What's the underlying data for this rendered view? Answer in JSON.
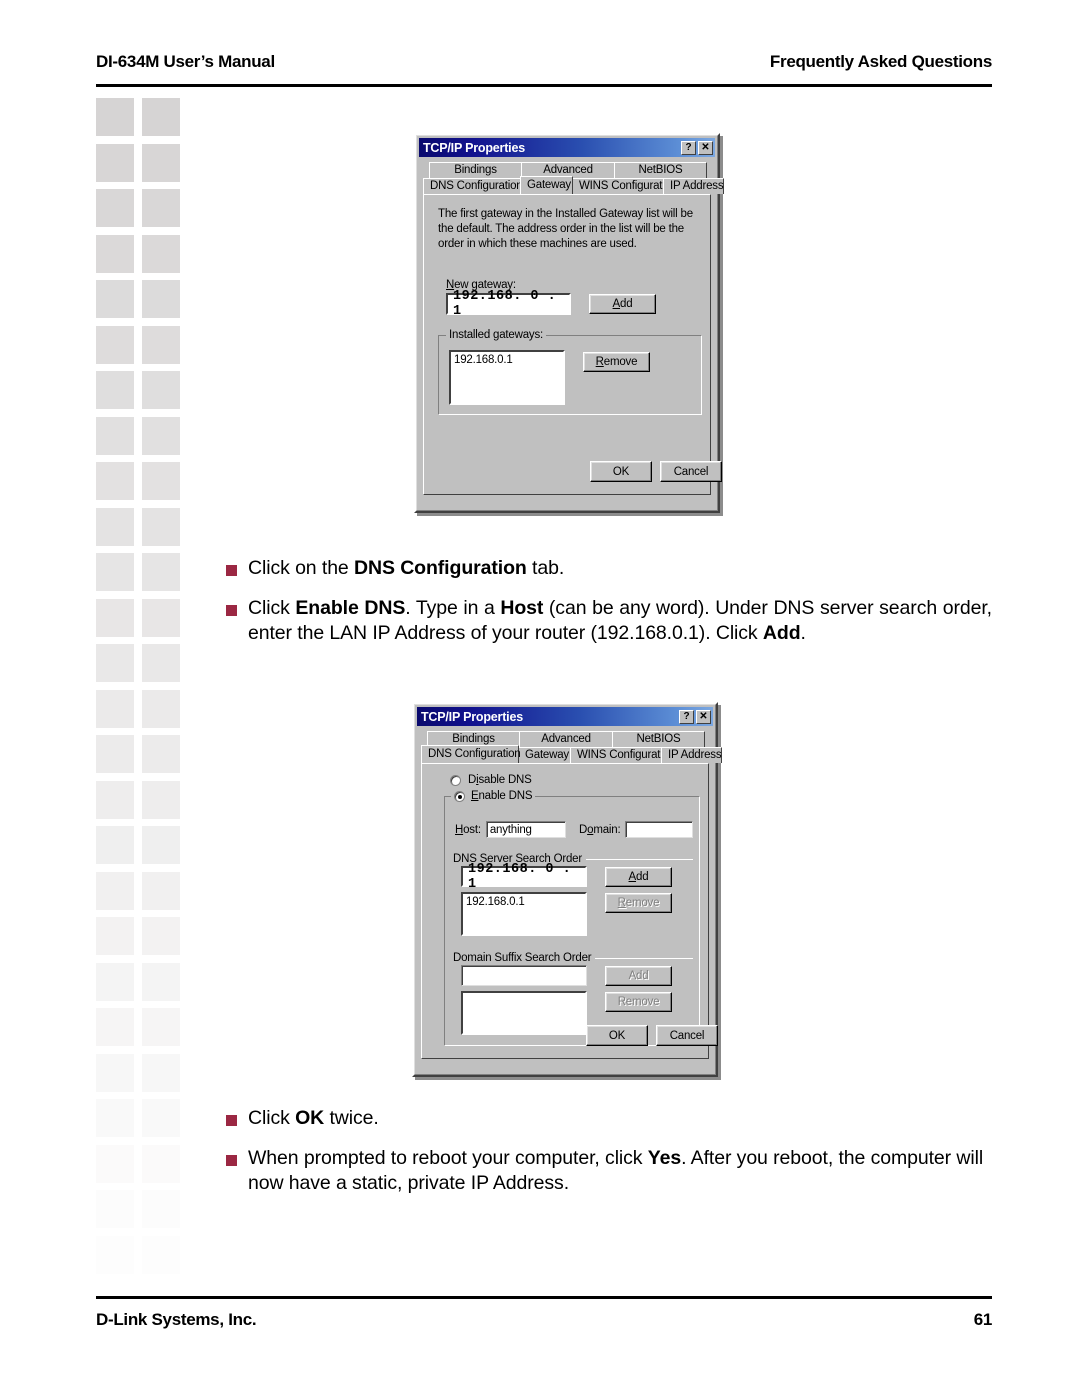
{
  "page": {
    "header_left": "DI-634M User’s Manual",
    "header_right": "Frequently Asked Questions",
    "footer_left": "D-Link Systems, Inc.",
    "footer_page_number": "61",
    "accent_bullet_color": "#9b2743",
    "decor_square_color": "#d6d4d4"
  },
  "dialog_gateway": {
    "title": "TCP/IP Properties",
    "help_button": "?",
    "close_button": "✕",
    "tabs_row1": [
      "Bindings",
      "Advanced",
      "NetBIOS"
    ],
    "tabs_row2": [
      "DNS Configuration",
      "Gateway",
      "WINS Configuration",
      "IP Address"
    ],
    "active_tab": "Gateway",
    "description": "The first gateway in the Installed Gateway list will be the default. The address order in the list will be the order in which these machines are used.",
    "new_gateway_label": "New gateway:",
    "new_gateway_value": "192.168.  0  .  1",
    "add_button": "Add",
    "installed_group_label": "Installed gateways:",
    "installed_list": [
      "192.168.0.1"
    ],
    "remove_button": "Remove",
    "ok_button": "OK",
    "cancel_button": "Cancel"
  },
  "bullets_middle": [
    {
      "parts": [
        {
          "t": "Click on the ",
          "b": false
        },
        {
          "t": "DNS Configuration",
          "b": true
        },
        {
          "t": " tab.",
          "b": false
        }
      ]
    },
    {
      "parts": [
        {
          "t": "Click ",
          "b": false
        },
        {
          "t": "Enable DNS",
          "b": true
        },
        {
          "t": ". Type in a ",
          "b": false
        },
        {
          "t": "Host",
          "b": true
        },
        {
          "t": " (can be any word). Under DNS server search order, enter the LAN IP Address of your router (192.168.0.1). Click ",
          "b": false
        },
        {
          "t": "Add",
          "b": true
        },
        {
          "t": ".",
          "b": false
        }
      ]
    }
  ],
  "dialog_dns": {
    "title": "TCP/IP Properties",
    "help_button": "?",
    "close_button": "✕",
    "tabs_row1": [
      "Bindings",
      "Advanced",
      "NetBIOS"
    ],
    "tabs_row2": [
      "DNS Configuration",
      "Gateway",
      "WINS Configuration",
      "IP Address"
    ],
    "active_tab": "DNS Configuration",
    "radio_disable_dns": "Disable DNS",
    "radio_enable_dns": "Enable DNS",
    "selected_radio": "Enable DNS",
    "host_label": "Host:",
    "host_value": "anything",
    "domain_label": "Domain:",
    "domain_value": "",
    "dns_group_label": "DNS Server Search Order",
    "dns_input_value": "192.168.  0  .  1",
    "dns_add_button": "Add",
    "dns_remove_button": "Remove",
    "dns_remove_disabled": true,
    "dns_list": [
      "192.168.0.1"
    ],
    "suffix_group_label": "Domain Suffix Search Order",
    "suffix_input_value": "",
    "suffix_add_button": "Add",
    "suffix_remove_button": "Remove",
    "suffix_add_disabled": true,
    "suffix_remove_disabled": true,
    "suffix_list": [],
    "ok_button": "OK",
    "cancel_button": "Cancel"
  },
  "bullets_bottom": [
    {
      "parts": [
        {
          "t": "Click ",
          "b": false
        },
        {
          "t": "OK",
          "b": true
        },
        {
          "t": " twice.",
          "b": false
        }
      ]
    },
    {
      "parts": [
        {
          "t": "When prompted to reboot your computer, click ",
          "b": false
        },
        {
          "t": "Yes",
          "b": true
        },
        {
          "t": ". After you reboot, the computer will now have a static, private IP Address.",
          "b": false
        }
      ]
    }
  ]
}
